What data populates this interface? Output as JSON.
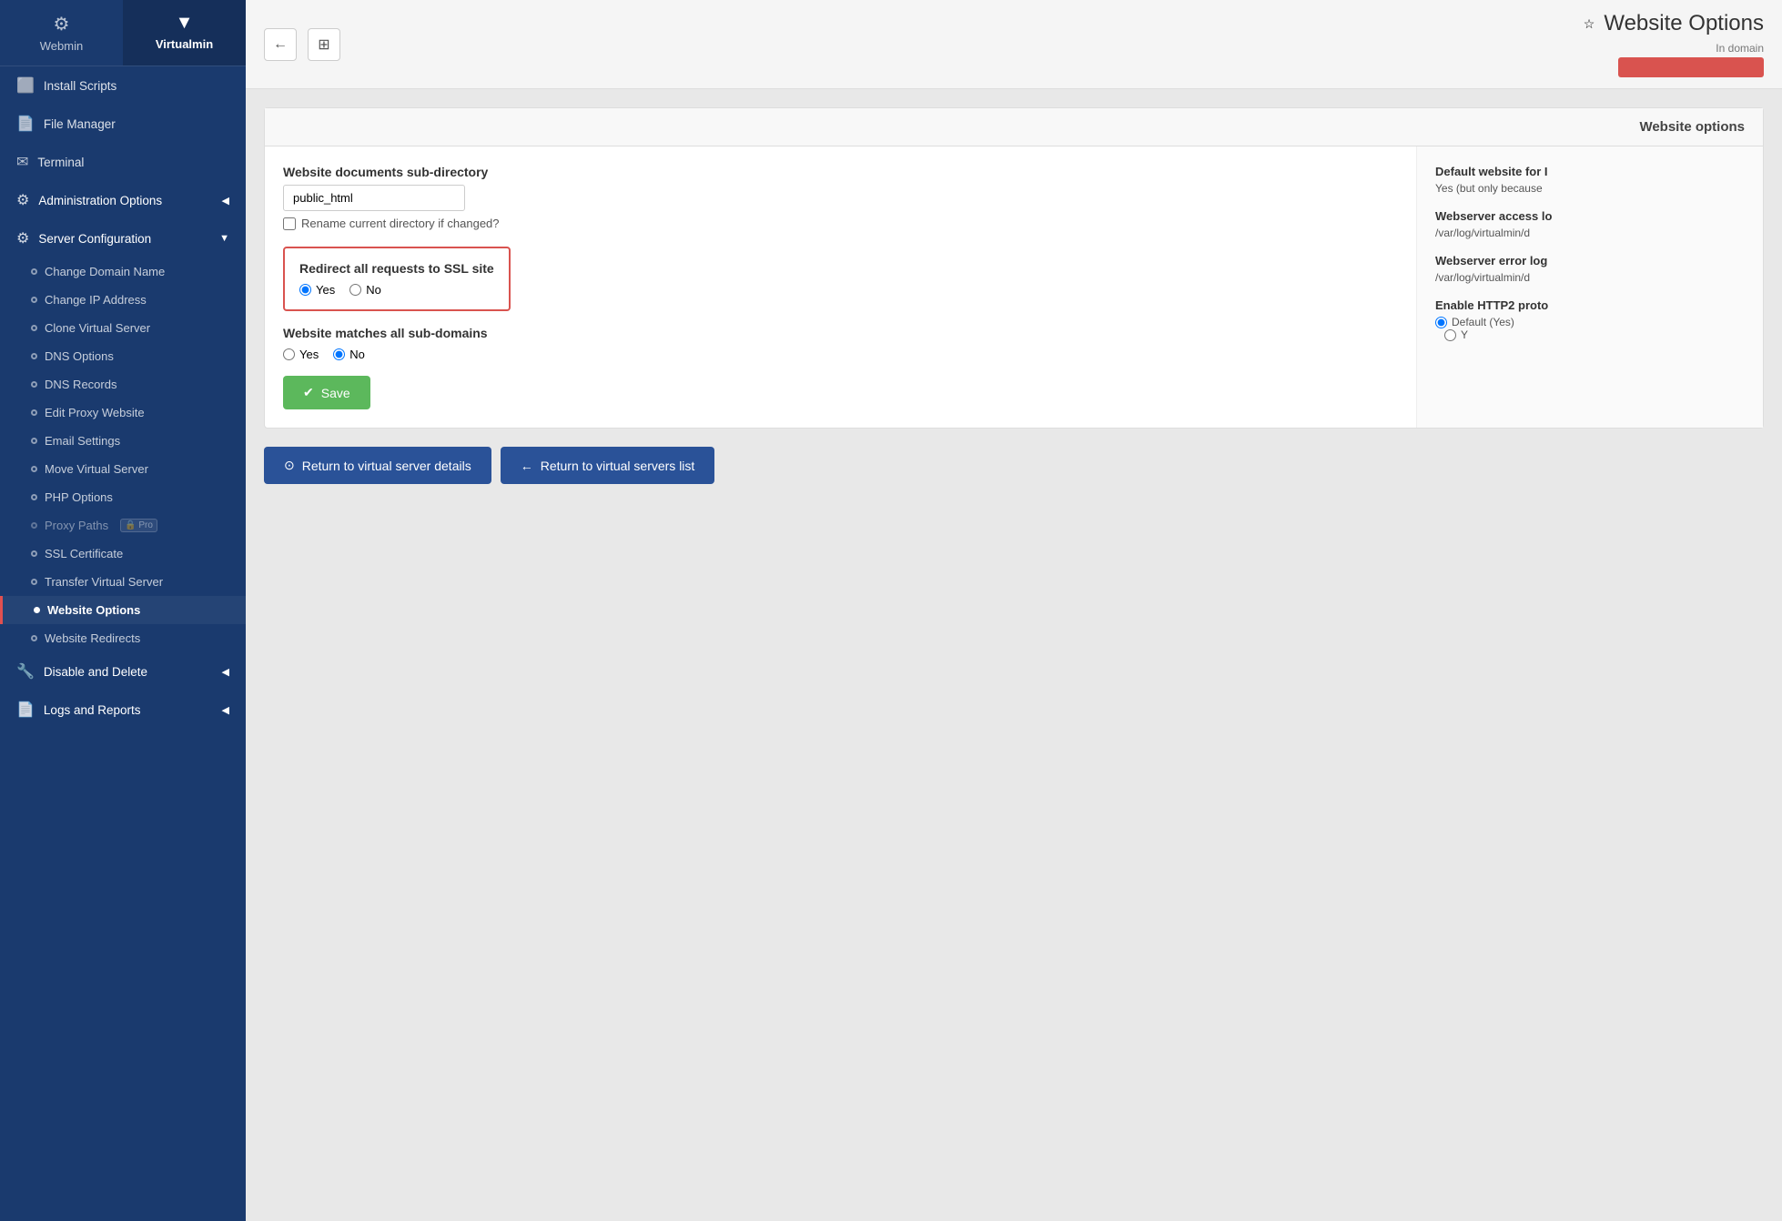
{
  "sidebar": {
    "tabs": [
      {
        "id": "webmin",
        "label": "Webmin",
        "icon": "⚙"
      },
      {
        "id": "virtualmin",
        "label": "Virtualmin",
        "icon": "▼",
        "active": true
      }
    ],
    "top_items": [
      {
        "id": "install-scripts",
        "label": "Install Scripts",
        "icon": "⬜"
      },
      {
        "id": "file-manager",
        "label": "File Manager",
        "icon": "📄"
      },
      {
        "id": "terminal",
        "label": "Terminal",
        "icon": "✉"
      }
    ],
    "sections": [
      {
        "id": "administration-options",
        "label": "Administration Options",
        "icon": "⚙",
        "has_arrow": true,
        "items": []
      },
      {
        "id": "server-configuration",
        "label": "Server Configuration",
        "icon": "⚙",
        "has_arrow": true,
        "items": [
          {
            "id": "change-domain-name",
            "label": "Change Domain Name",
            "active": false
          },
          {
            "id": "change-ip-address",
            "label": "Change IP Address",
            "active": false
          },
          {
            "id": "clone-virtual-server",
            "label": "Clone Virtual Server",
            "active": false
          },
          {
            "id": "dns-options",
            "label": "DNS Options",
            "active": false
          },
          {
            "id": "dns-records",
            "label": "DNS Records",
            "active": false
          },
          {
            "id": "edit-proxy-website",
            "label": "Edit Proxy Website",
            "active": false
          },
          {
            "id": "email-settings",
            "label": "Email Settings",
            "active": false
          },
          {
            "id": "move-virtual-server",
            "label": "Move Virtual Server",
            "active": false
          },
          {
            "id": "php-options",
            "label": "PHP Options",
            "active": false
          },
          {
            "id": "proxy-paths",
            "label": "Proxy Paths",
            "active": false,
            "pro": true
          },
          {
            "id": "ssl-certificate",
            "label": "SSL Certificate",
            "active": false
          },
          {
            "id": "transfer-virtual-server",
            "label": "Transfer Virtual Server",
            "active": false
          },
          {
            "id": "website-options",
            "label": "Website Options",
            "active": true
          },
          {
            "id": "website-redirects",
            "label": "Website Redirects",
            "active": false
          }
        ]
      },
      {
        "id": "disable-and-delete",
        "label": "Disable and Delete",
        "icon": "🔧",
        "has_arrow": true,
        "items": []
      },
      {
        "id": "logs-and-reports",
        "label": "Logs and Reports",
        "icon": "📄",
        "has_arrow": true,
        "items": []
      }
    ]
  },
  "topbar": {
    "back_btn": "←",
    "grid_btn": "⊞",
    "star_icon": "☆",
    "title": "Website Options",
    "domain_label": "In domain",
    "domain_color": "#d9534f"
  },
  "panel": {
    "header": "Website options",
    "fields": {
      "docs_subdir_label": "Website documents sub-directory",
      "docs_subdir_value": "public_html",
      "rename_check_label": "Rename current directory if changed?",
      "redirect_label": "Redirect all requests to SSL site",
      "redirect_yes": "Yes",
      "redirect_no": "No",
      "subdomain_label": "Website matches all sub-domains",
      "subdomain_yes": "Yes",
      "subdomain_no": "No"
    },
    "right_col": {
      "default_website_label": "Default website for I",
      "default_website_value": "Yes (but only because",
      "access_log_label": "Webserver access lo",
      "access_log_value": "/var/log/virtualmin/d",
      "error_log_label": "Webserver error log",
      "error_log_value": "/var/log/virtualmin/d",
      "http2_label": "Enable HTTP2 proto",
      "http2_value": "Default (Yes)"
    },
    "save_btn": "Save"
  },
  "bottom_actions": [
    {
      "id": "return-details",
      "label": "Return to virtual server details",
      "icon": "⊙"
    },
    {
      "id": "return-list",
      "label": "Return to virtual servers list",
      "icon": "←"
    }
  ]
}
